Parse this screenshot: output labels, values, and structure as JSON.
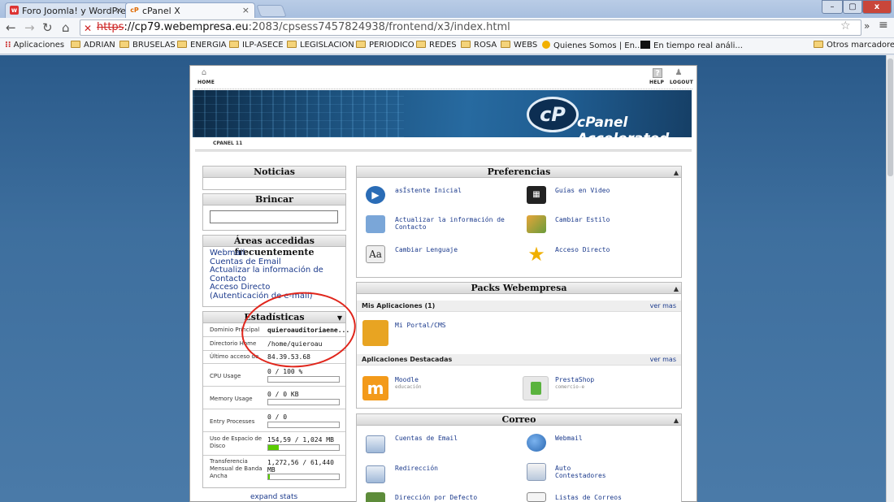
{
  "browser": {
    "tabs": [
      {
        "icon": "w",
        "label": "Foro Joomla! y WordPress"
      },
      {
        "icon": "cP",
        "label": "cPanel X"
      }
    ],
    "url": {
      "scheme": "https",
      "host": "://cp79.webempresa.eu",
      "rest": ":2083/cpsess7457824938/frontend/x3/index.html"
    },
    "bookmarks": [
      "Aplicaciones",
      "ADRIAN",
      "BRUSELAS",
      "ENERGIA",
      "ILP-ASECE",
      "LEGISLACION",
      "PERIODICO",
      "REDES",
      "ROSA",
      "WEBS",
      "Quienes Somos | En...",
      "En tiempo real análi...",
      "Otros marcadores"
    ],
    "win_controls": {
      "minimize": "–",
      "maximize": "▢",
      "close": "x"
    }
  },
  "cpanel": {
    "top": {
      "home": "HOME",
      "help": "HELP",
      "logout": "LOGOUT"
    },
    "banner": {
      "logo_mark": "cP",
      "logo_text": "cPanel Accelerated",
      "logo_sub": "2"
    },
    "version": "CPANEL 11",
    "news": {
      "title": "Noticias"
    },
    "jump": {
      "title": "Brincar"
    },
    "frequent": {
      "title": "Áreas accedidas frecuentemente",
      "links": [
        "Webmail",
        "Cuentas de Email",
        "Actualizar la información de Contacto",
        "Acceso Directo",
        "(Autenticación de e-mail)"
      ]
    },
    "stats": {
      "title": "Estadísticas",
      "rows": [
        {
          "label": "Dominio Principal",
          "value": "quieroauditoriaene..."
        },
        {
          "label": "Directorio Home",
          "value": "/home/quieroau"
        },
        {
          "label": "Último acceso de",
          "value": "84.39.53.68"
        }
      ],
      "bars": [
        {
          "label": "CPU Usage",
          "value": "0 / 100 %",
          "fraction": 0
        },
        {
          "label": "Memory Usage",
          "value": "0 / 0 KB",
          "fraction": 0
        },
        {
          "label": "Entry Processes",
          "value": "0 / 0",
          "fraction": 0
        },
        {
          "label": "Uso de Espacio de Disco",
          "value": "154,59 / 1,024 MB",
          "fraction": 0.151
        },
        {
          "label": "Transferencia Mensual de Banda Ancha",
          "value": "1,272,56 / 61,440 MB",
          "fraction": 0.021
        }
      ],
      "expand": "expand stats"
    },
    "prefs": {
      "title": "Preferencias",
      "items": [
        "asÍstente Inicial",
        "Guías en Video",
        "Actualizar la información de Contacto",
        "Cambiar Estilo",
        "Cambiar Lenguaje",
        "Acceso Directo"
      ]
    },
    "packs": {
      "title": "Packs Webempresa",
      "mine": {
        "title": "Mis Aplicaciones (1)",
        "more": "ver mas"
      },
      "mine_items": [
        "Mi Portal/CMS"
      ],
      "featured": {
        "title": "Aplicaciones Destacadas",
        "more": "ver mas"
      },
      "featured_items": [
        {
          "label": "Moodle",
          "sub": "educación"
        },
        {
          "label": "PrestaShop",
          "sub": "comercio-e"
        }
      ]
    },
    "mail": {
      "title": "Correo",
      "items": [
        "Cuentas de Email",
        "Webmail",
        "Redirección",
        "Auto Contestadores",
        "Dirección por Defecto",
        "Listas de Correos"
      ]
    }
  }
}
